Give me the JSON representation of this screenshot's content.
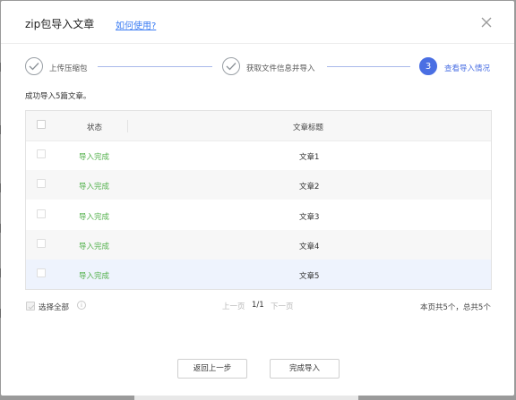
{
  "dialog": {
    "title": "zip包导入文章",
    "help_link": "如何使用?"
  },
  "steps": [
    {
      "label": "上传压缩包",
      "state": "done",
      "icon": "check-icon"
    },
    {
      "label": "获取文件信息并导入",
      "state": "done",
      "icon": "check-icon"
    },
    {
      "label": "查看导入情况",
      "state": "active",
      "number": "3"
    }
  ],
  "import_message": "成功导入5篇文章。",
  "table": {
    "headers": {
      "status": "状态",
      "title": "文章标题"
    },
    "rows": [
      {
        "status": "导入完成",
        "title": "文章1"
      },
      {
        "status": "导入完成",
        "title": "文章2"
      },
      {
        "status": "导入完成",
        "title": "文章3"
      },
      {
        "status": "导入完成",
        "title": "文章4"
      },
      {
        "status": "导入完成",
        "title": "文章5"
      }
    ]
  },
  "footer": {
    "select_all_label": "选择全部",
    "info_icon": "i",
    "pager": {
      "prev": "上一页",
      "current": "1/1",
      "next": "下一页"
    },
    "summary": "本页共5个，总共5个"
  },
  "buttons": {
    "back": "返回上一步",
    "done": "完成导入"
  },
  "colors": {
    "accent": "#4a6fe3",
    "success": "#52b04b",
    "link": "#3b7cf3"
  }
}
